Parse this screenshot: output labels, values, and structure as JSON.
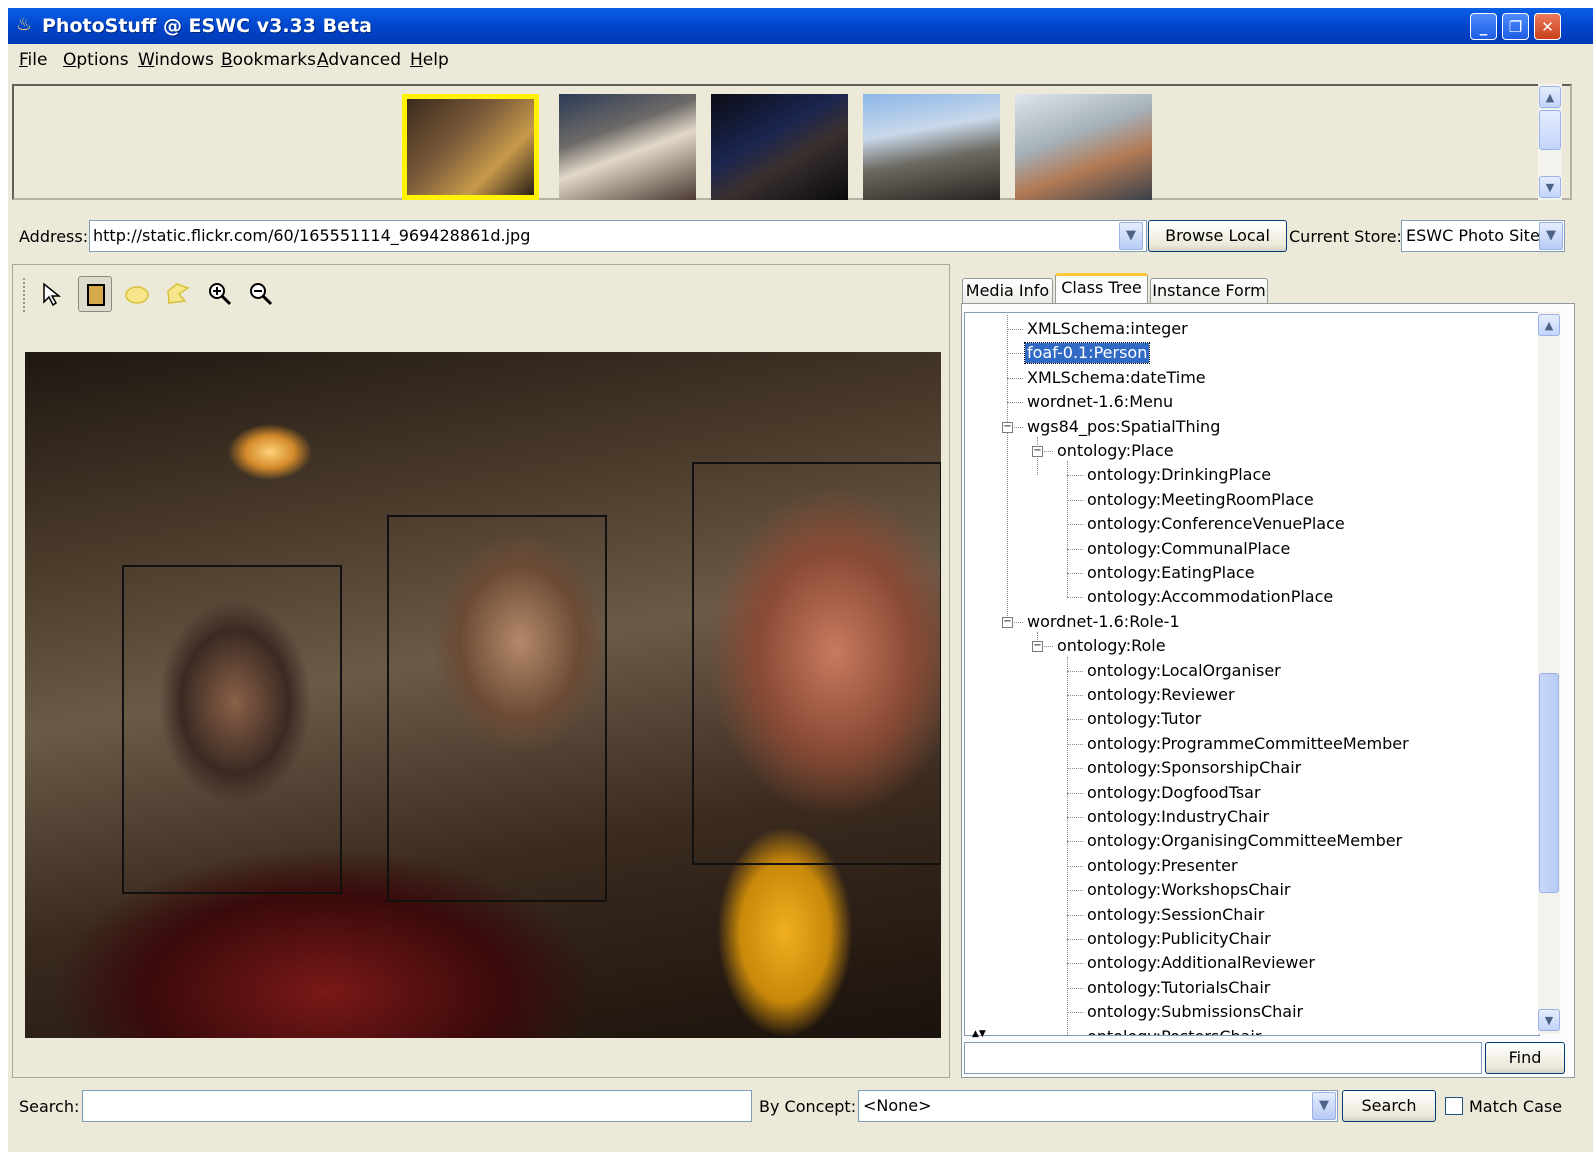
{
  "window": {
    "title": "PhotoStuff @ ESWC v3.33 Beta",
    "controls": {
      "minimize": "_",
      "maximize": "❐",
      "close": "✕"
    }
  },
  "menu": [
    {
      "label": "File"
    },
    {
      "label": "Options"
    },
    {
      "label": "Windows"
    },
    {
      "label": "Bookmarks"
    },
    {
      "label": "Advanced"
    },
    {
      "label": "Help"
    }
  ],
  "address": {
    "label": "Address:",
    "value": "http://static.flickr.com/60/165551114_969428861d.jpg",
    "browse_label": "Browse Local",
    "store_label": "Current Store:",
    "store_value": "ESWC Photo Site"
  },
  "tabs": [
    {
      "label": "Media Info",
      "active": false
    },
    {
      "label": "Class Tree",
      "active": true
    },
    {
      "label": "Instance Form",
      "active": false
    }
  ],
  "tree": [
    {
      "label": "XMLSchema:integer",
      "level": 1
    },
    {
      "label": "foaf-0.1:Person",
      "level": 1,
      "selected": true
    },
    {
      "label": "XMLSchema:dateTime",
      "level": 1
    },
    {
      "label": "wordnet-1.6:Menu",
      "level": 1
    },
    {
      "label": "wgs84_pos:SpatialThing",
      "level": 1,
      "expanded": true
    },
    {
      "label": "ontology:Place",
      "level": 2,
      "expanded": true
    },
    {
      "label": "ontology:DrinkingPlace",
      "level": 3
    },
    {
      "label": "ontology:MeetingRoomPlace",
      "level": 3
    },
    {
      "label": "ontology:ConferenceVenuePlace",
      "level": 3
    },
    {
      "label": "ontology:CommunalPlace",
      "level": 3
    },
    {
      "label": "ontology:EatingPlace",
      "level": 3
    },
    {
      "label": "ontology:AccommodationPlace",
      "level": 3
    },
    {
      "label": "wordnet-1.6:Role-1",
      "level": 1,
      "expanded": true
    },
    {
      "label": "ontology:Role",
      "level": 2,
      "expanded": true
    },
    {
      "label": "ontology:LocalOrganiser",
      "level": 3
    },
    {
      "label": "ontology:Reviewer",
      "level": 3
    },
    {
      "label": "ontology:Tutor",
      "level": 3
    },
    {
      "label": "ontology:ProgrammeCommitteeMember",
      "level": 3
    },
    {
      "label": "ontology:SponsorshipChair",
      "level": 3
    },
    {
      "label": "ontology:DogfoodTsar",
      "level": 3
    },
    {
      "label": "ontology:IndustryChair",
      "level": 3
    },
    {
      "label": "ontology:OrganisingCommitteeMember",
      "level": 3
    },
    {
      "label": "ontology:Presenter",
      "level": 3
    },
    {
      "label": "ontology:WorkshopsChair",
      "level": 3
    },
    {
      "label": "ontology:SessionChair",
      "level": 3
    },
    {
      "label": "ontology:PublicityChair",
      "level": 3
    },
    {
      "label": "ontology:AdditionalReviewer",
      "level": 3
    },
    {
      "label": "ontology:TutorialsChair",
      "level": 3
    },
    {
      "label": "ontology:SubmissionsChair",
      "level": 3
    },
    {
      "label": "ontology:PostersChair",
      "level": 3
    }
  ],
  "find": {
    "label": "Find",
    "value": ""
  },
  "search": {
    "label": "Search:",
    "value": "",
    "concept_label": "By Concept:",
    "concept_value": "<None>",
    "button_label": "Search",
    "match_case_label": "Match Case",
    "match_case_checked": false
  },
  "tools": [
    {
      "icon": "arrow-select-icon",
      "selected": false
    },
    {
      "icon": "rectangle-region-icon",
      "selected": true
    },
    {
      "icon": "ellipse-region-icon",
      "selected": false
    },
    {
      "icon": "polygon-region-icon",
      "selected": false
    },
    {
      "icon": "zoom-in-icon",
      "selected": false
    },
    {
      "icon": "zoom-out-icon",
      "selected": false
    }
  ],
  "colors": {
    "titlebar": "#0142c7",
    "selection": "#316ac5",
    "thumb_highlight": "#fff300",
    "active_tab": "#ffc83c"
  }
}
